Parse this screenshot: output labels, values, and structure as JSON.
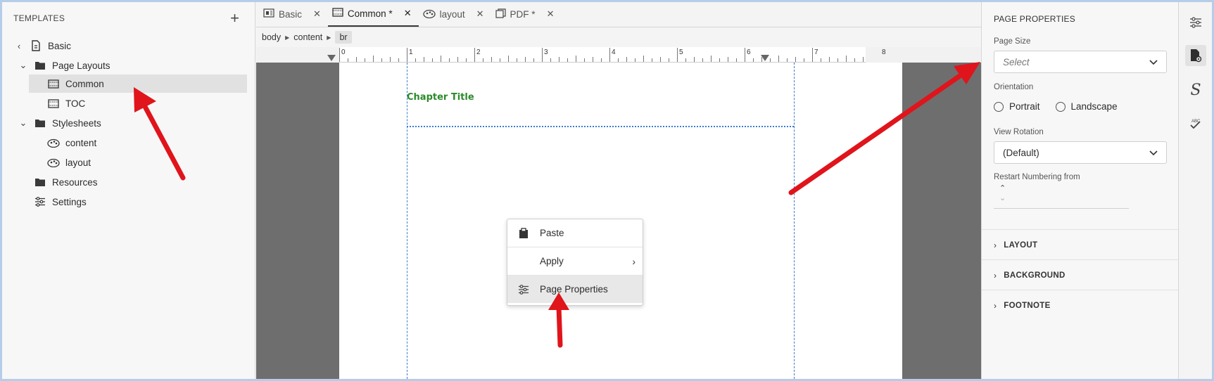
{
  "left_panel": {
    "title": "TEMPLATES",
    "add_icon": "plus-icon",
    "tree": [
      {
        "label": "Basic",
        "icon": "document-icon"
      },
      {
        "label": "Page Layouts",
        "icon": "folder-icon"
      },
      {
        "label": "Common",
        "icon": "page-layout-icon",
        "selected": true
      },
      {
        "label": "TOC",
        "icon": "page-layout-icon"
      },
      {
        "label": "Stylesheets",
        "icon": "folder-icon"
      },
      {
        "label": "content",
        "icon": "stylesheet-icon"
      },
      {
        "label": "layout",
        "icon": "stylesheet-icon"
      },
      {
        "label": "Resources",
        "icon": "folder-icon"
      },
      {
        "label": "Settings",
        "icon": "settings-sliders-icon"
      }
    ]
  },
  "tabs": [
    {
      "label": "Basic",
      "icon": "document-icon"
    },
    {
      "label": "Common *",
      "icon": "page-layout-icon",
      "active": true
    },
    {
      "label": "layout",
      "icon": "stylesheet-icon"
    },
    {
      "label": "PDF *",
      "icon": "pdf-icon"
    }
  ],
  "breadcrumb": [
    "body",
    "content",
    "br"
  ],
  "ruler": {
    "labels": [
      "0",
      "1",
      "2",
      "3",
      "4",
      "5",
      "6",
      "7",
      "8"
    ]
  },
  "page": {
    "chapter_title": "Chapter Title",
    "chapter_title_color": "#2b8a2b"
  },
  "context_menu": {
    "items": [
      {
        "label": "Paste",
        "icon": "clipboard-icon"
      },
      {
        "label": "Apply",
        "icon": "",
        "submenu": true
      },
      {
        "label": "Page Properties",
        "icon": "settings-sliders-icon",
        "highlighted": true
      }
    ]
  },
  "properties": {
    "title": "PAGE PROPERTIES",
    "page_size_label": "Page Size",
    "page_size_placeholder": "Select",
    "orientation_label": "Orientation",
    "orientation_options": [
      "Portrait",
      "Landscape"
    ],
    "view_rotation_label": "View Rotation",
    "view_rotation_value": "(Default)",
    "restart_label": "Restart Numbering from",
    "sections": [
      "LAYOUT",
      "BACKGROUND",
      "FOOTNOTE"
    ]
  },
  "rail_icons": [
    "settings-sliders-icon",
    "page-properties-icon",
    "style-s-icon",
    "spell-check-icon"
  ],
  "annotation_color": "#e0141b"
}
